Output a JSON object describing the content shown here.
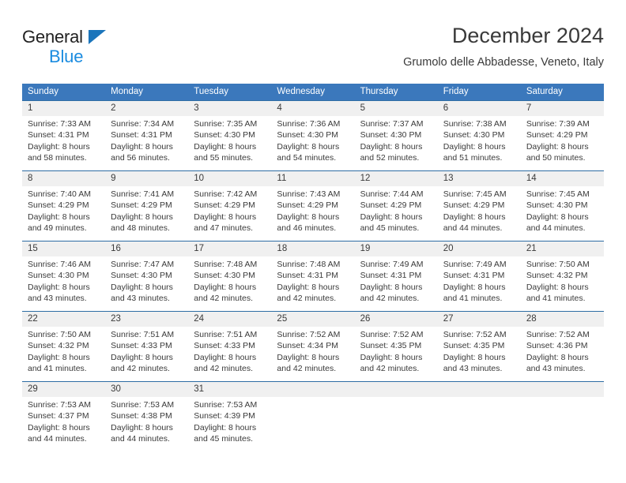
{
  "brand": {
    "name_part1": "General",
    "name_part2": "Blue",
    "logo_icon": "triangle-logo-icon"
  },
  "header": {
    "title": "December 2024",
    "subtitle": "Grumolo delle Abbadesse, Veneto, Italy"
  },
  "colors": {
    "header_blue": "#3b78bc",
    "cell_border_blue": "#2e6da4",
    "daynum_band": "#f0f0f0",
    "brand_blue": "#1b8ce0",
    "logo_blue": "#1b75bb",
    "text": "#3a3a3a"
  },
  "calendar": {
    "weekday_headers": [
      "Sunday",
      "Monday",
      "Tuesday",
      "Wednesday",
      "Thursday",
      "Friday",
      "Saturday"
    ],
    "weeks": [
      [
        {
          "day": "1",
          "lines": [
            "Sunrise: 7:33 AM",
            "Sunset: 4:31 PM",
            "Daylight: 8 hours",
            "and 58 minutes."
          ]
        },
        {
          "day": "2",
          "lines": [
            "Sunrise: 7:34 AM",
            "Sunset: 4:31 PM",
            "Daylight: 8 hours",
            "and 56 minutes."
          ]
        },
        {
          "day": "3",
          "lines": [
            "Sunrise: 7:35 AM",
            "Sunset: 4:30 PM",
            "Daylight: 8 hours",
            "and 55 minutes."
          ]
        },
        {
          "day": "4",
          "lines": [
            "Sunrise: 7:36 AM",
            "Sunset: 4:30 PM",
            "Daylight: 8 hours",
            "and 54 minutes."
          ]
        },
        {
          "day": "5",
          "lines": [
            "Sunrise: 7:37 AM",
            "Sunset: 4:30 PM",
            "Daylight: 8 hours",
            "and 52 minutes."
          ]
        },
        {
          "day": "6",
          "lines": [
            "Sunrise: 7:38 AM",
            "Sunset: 4:30 PM",
            "Daylight: 8 hours",
            "and 51 minutes."
          ]
        },
        {
          "day": "7",
          "lines": [
            "Sunrise: 7:39 AM",
            "Sunset: 4:29 PM",
            "Daylight: 8 hours",
            "and 50 minutes."
          ]
        }
      ],
      [
        {
          "day": "8",
          "lines": [
            "Sunrise: 7:40 AM",
            "Sunset: 4:29 PM",
            "Daylight: 8 hours",
            "and 49 minutes."
          ]
        },
        {
          "day": "9",
          "lines": [
            "Sunrise: 7:41 AM",
            "Sunset: 4:29 PM",
            "Daylight: 8 hours",
            "and 48 minutes."
          ]
        },
        {
          "day": "10",
          "lines": [
            "Sunrise: 7:42 AM",
            "Sunset: 4:29 PM",
            "Daylight: 8 hours",
            "and 47 minutes."
          ]
        },
        {
          "day": "11",
          "lines": [
            "Sunrise: 7:43 AM",
            "Sunset: 4:29 PM",
            "Daylight: 8 hours",
            "and 46 minutes."
          ]
        },
        {
          "day": "12",
          "lines": [
            "Sunrise: 7:44 AM",
            "Sunset: 4:29 PM",
            "Daylight: 8 hours",
            "and 45 minutes."
          ]
        },
        {
          "day": "13",
          "lines": [
            "Sunrise: 7:45 AM",
            "Sunset: 4:29 PM",
            "Daylight: 8 hours",
            "and 44 minutes."
          ]
        },
        {
          "day": "14",
          "lines": [
            "Sunrise: 7:45 AM",
            "Sunset: 4:30 PM",
            "Daylight: 8 hours",
            "and 44 minutes."
          ]
        }
      ],
      [
        {
          "day": "15",
          "lines": [
            "Sunrise: 7:46 AM",
            "Sunset: 4:30 PM",
            "Daylight: 8 hours",
            "and 43 minutes."
          ]
        },
        {
          "day": "16",
          "lines": [
            "Sunrise: 7:47 AM",
            "Sunset: 4:30 PM",
            "Daylight: 8 hours",
            "and 43 minutes."
          ]
        },
        {
          "day": "17",
          "lines": [
            "Sunrise: 7:48 AM",
            "Sunset: 4:30 PM",
            "Daylight: 8 hours",
            "and 42 minutes."
          ]
        },
        {
          "day": "18",
          "lines": [
            "Sunrise: 7:48 AM",
            "Sunset: 4:31 PM",
            "Daylight: 8 hours",
            "and 42 minutes."
          ]
        },
        {
          "day": "19",
          "lines": [
            "Sunrise: 7:49 AM",
            "Sunset: 4:31 PM",
            "Daylight: 8 hours",
            "and 42 minutes."
          ]
        },
        {
          "day": "20",
          "lines": [
            "Sunrise: 7:49 AM",
            "Sunset: 4:31 PM",
            "Daylight: 8 hours",
            "and 41 minutes."
          ]
        },
        {
          "day": "21",
          "lines": [
            "Sunrise: 7:50 AM",
            "Sunset: 4:32 PM",
            "Daylight: 8 hours",
            "and 41 minutes."
          ]
        }
      ],
      [
        {
          "day": "22",
          "lines": [
            "Sunrise: 7:50 AM",
            "Sunset: 4:32 PM",
            "Daylight: 8 hours",
            "and 41 minutes."
          ]
        },
        {
          "day": "23",
          "lines": [
            "Sunrise: 7:51 AM",
            "Sunset: 4:33 PM",
            "Daylight: 8 hours",
            "and 42 minutes."
          ]
        },
        {
          "day": "24",
          "lines": [
            "Sunrise: 7:51 AM",
            "Sunset: 4:33 PM",
            "Daylight: 8 hours",
            "and 42 minutes."
          ]
        },
        {
          "day": "25",
          "lines": [
            "Sunrise: 7:52 AM",
            "Sunset: 4:34 PM",
            "Daylight: 8 hours",
            "and 42 minutes."
          ]
        },
        {
          "day": "26",
          "lines": [
            "Sunrise: 7:52 AM",
            "Sunset: 4:35 PM",
            "Daylight: 8 hours",
            "and 42 minutes."
          ]
        },
        {
          "day": "27",
          "lines": [
            "Sunrise: 7:52 AM",
            "Sunset: 4:35 PM",
            "Daylight: 8 hours",
            "and 43 minutes."
          ]
        },
        {
          "day": "28",
          "lines": [
            "Sunrise: 7:52 AM",
            "Sunset: 4:36 PM",
            "Daylight: 8 hours",
            "and 43 minutes."
          ]
        }
      ],
      [
        {
          "day": "29",
          "lines": [
            "Sunrise: 7:53 AM",
            "Sunset: 4:37 PM",
            "Daylight: 8 hours",
            "and 44 minutes."
          ]
        },
        {
          "day": "30",
          "lines": [
            "Sunrise: 7:53 AM",
            "Sunset: 4:38 PM",
            "Daylight: 8 hours",
            "and 44 minutes."
          ]
        },
        {
          "day": "31",
          "lines": [
            "Sunrise: 7:53 AM",
            "Sunset: 4:39 PM",
            "Daylight: 8 hours",
            "and 45 minutes."
          ]
        },
        {
          "day": "",
          "lines": []
        },
        {
          "day": "",
          "lines": []
        },
        {
          "day": "",
          "lines": []
        },
        {
          "day": "",
          "lines": []
        }
      ]
    ]
  }
}
